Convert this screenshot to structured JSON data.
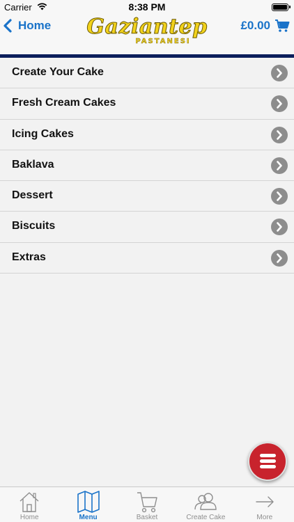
{
  "status_bar": {
    "carrier": "Carrier",
    "time": "8:38 PM"
  },
  "nav": {
    "back_label": "Home",
    "logo": {
      "title": "Gaziantep",
      "subtitle": "PASTANESI"
    },
    "cart_total": "£0.00"
  },
  "menu": {
    "items": [
      {
        "label": "Create Your Cake"
      },
      {
        "label": "Fresh Cream Cakes"
      },
      {
        "label": "Icing Cakes"
      },
      {
        "label": "Baklava"
      },
      {
        "label": "Dessert"
      },
      {
        "label": "Biscuits"
      },
      {
        "label": "Extras"
      }
    ]
  },
  "tabs": {
    "items": [
      {
        "label": "Home",
        "icon": "house-icon"
      },
      {
        "label": "Menu",
        "icon": "map-icon",
        "active": true
      },
      {
        "label": "Basket",
        "icon": "cart-icon"
      },
      {
        "label": "Create Cake",
        "icon": "people-icon"
      },
      {
        "label": "More",
        "icon": "arrow-right-icon"
      }
    ]
  },
  "colors": {
    "accent": "#1a73c9",
    "nav_rule": "#0c1f5c",
    "fab": "#c8232d",
    "logo": "#f2d21b"
  }
}
